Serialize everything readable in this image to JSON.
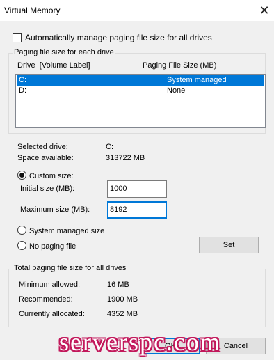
{
  "window": {
    "title": "Virtual Memory",
    "close_icon": "close-icon"
  },
  "auto_manage": {
    "label": "Automatically manage paging file size for all drives",
    "checked": false
  },
  "per_drive": {
    "legend": "Paging file size for each drive",
    "col_drive": "Drive  [Volume Label]",
    "col_size": "Paging File Size (MB)",
    "rows": [
      {
        "drive": "C:",
        "size": "System managed",
        "selected": true
      },
      {
        "drive": "D:",
        "size": "None",
        "selected": false
      }
    ]
  },
  "info": {
    "selected_drive_label": "Selected drive:",
    "selected_drive_value": "C:",
    "space_label": "Space available:",
    "space_value": "313722 MB"
  },
  "options": {
    "custom_label": "Custom size:",
    "initial_label": "Initial size (MB):",
    "initial_value": "1000",
    "maximum_label": "Maximum size (MB):",
    "maximum_value": "8192",
    "system_label": "System managed size",
    "nopaging_label": "No paging file",
    "selected": "custom",
    "set_label": "Set"
  },
  "totals": {
    "legend": "Total paging file size for all drives",
    "min_label": "Minimum allowed:",
    "min_value": "16 MB",
    "rec_label": "Recommended:",
    "rec_value": "1900 MB",
    "cur_label": "Currently allocated:",
    "cur_value": "4352 MB"
  },
  "footer": {
    "ok_label": "OK",
    "cancel_label": "Cancel"
  },
  "watermark": "serverspc.com",
  "colors": {
    "accent": "#0078d7",
    "watermark": "#c2185b"
  }
}
